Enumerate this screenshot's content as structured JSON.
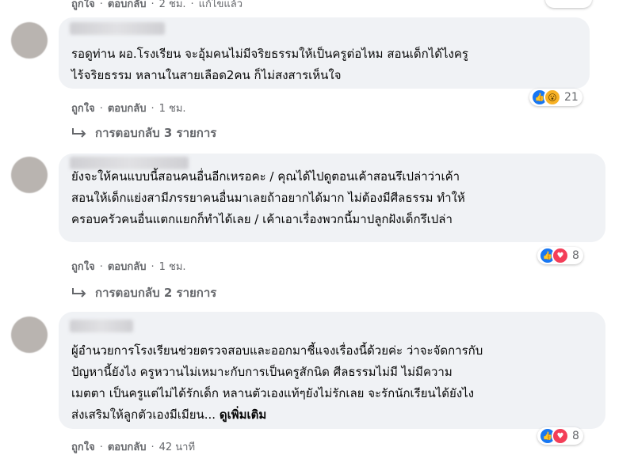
{
  "top_meta": {
    "like": "ถูกใจ",
    "reply": "ตอบกลับ",
    "time": "2 ชม.",
    "edited": "แก้ไขแล้ว"
  },
  "comments": [
    {
      "lines": [
        "รอดูท่าน ผอ.โรงเรียน จะอุ้มคนไม่มีจริยธรรมให้เป็นครูต่อไหม สอนเด็กได้ไงครู",
        "ไร้จริยธรรม หลานในสายเลือด2คน ก็ไม่สงสารเห็นใจ"
      ],
      "like": "ถูกใจ",
      "reply": "ตอบกลับ",
      "time": "1 ชม.",
      "reaction_icons": [
        "like-icon",
        "wow-icon"
      ],
      "reaction_count": "21",
      "replies_label": "การตอบกลับ 3 รายการ"
    },
    {
      "lines": [
        "ยังจะให้คนแบบนี้สอนคนอื่นอีกเหรอคะ / คุณได้ไปดูตอนเค้าสอนรึเปล่าว่าเค้า",
        "สอนให้เด็กแย่งสามีภรรยาคนอื่นมาเลยถ้าอยากได้มาก ไม่ต้องมีศีลธรรม ทำให้",
        "ครอบครัวคนอื่นแตกแยกก็ทำได้เลย / เค้าเอาเรื่องพวกนี้มาปลูกฝังเด็กรึเปล่า"
      ],
      "like": "ถูกใจ",
      "reply": "ตอบกลับ",
      "time": "1 ชม.",
      "reaction_icons": [
        "like-icon",
        "love-icon"
      ],
      "reaction_count": "8",
      "replies_label": "การตอบกลับ 2 รายการ"
    },
    {
      "lines": [
        "ผู้อำนวยการโรงเรียนช่วยตรวจสอบและออกมาชี้แจงเรื่องนี้ด้วยค่ะ ว่าจะจัดการกับ",
        "ปัญหานี้ยังไง ครูหวานไม่เหมาะกับการเป็นครูสักนิด ศีลธรรมไม่มี ไม่มีความ",
        "เมตตา เป็นครูแต่ไม่ได้รักเด็ก หลานตัวเองแท้ๆยังไม่รักเลย จะรักนักเรียนได้ยังไง",
        "ส่งเสริมให้ลูกตัวเองมีเมียน..."
      ],
      "see_more": "ดูเพิ่มเติม",
      "like": "ถูกใจ",
      "reply": "ตอบกลับ",
      "time": "42 นาที",
      "reaction_icons": [
        "like-icon",
        "love-icon"
      ],
      "reaction_count": "8"
    }
  ]
}
